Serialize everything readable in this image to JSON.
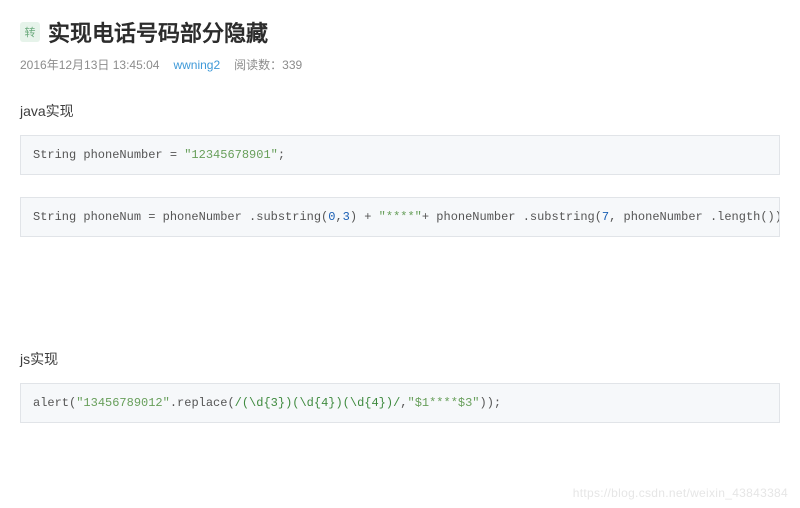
{
  "header": {
    "badge": "转",
    "title": "实现电话号码部分隐藏"
  },
  "meta": {
    "date": "2016年12月13日 13:45:04",
    "author": "wwning2",
    "views_label": "阅读数：339"
  },
  "sections": {
    "java_heading": "java实现",
    "js_heading": "js实现"
  },
  "code": {
    "java1_p1": "String phoneNumber = ",
    "java1_str": "\"12345678901\"",
    "java1_p2": ";",
    "java2_p1": "String phoneNum = phoneNumber .substring(",
    "java2_n1": "0",
    "java2_p2": ",",
    "java2_n2": "3",
    "java2_p3": ") + ",
    "java2_str": "\"****\"",
    "java2_p4": "+ phoneNumber .substring(",
    "java2_n3": "7",
    "java2_p5": ", phoneNumber .length());",
    "js_p1": "alert(",
    "js_str1": "\"13456789012\"",
    "js_p2": ".replace(",
    "js_rgx": "/(\\d{3})(\\d{4})(\\d{4})/",
    "js_p3": ",",
    "js_str2": "\"$1****$3\"",
    "js_p4": "));"
  },
  "watermark": "https://blog.csdn.net/weixin_43843384"
}
